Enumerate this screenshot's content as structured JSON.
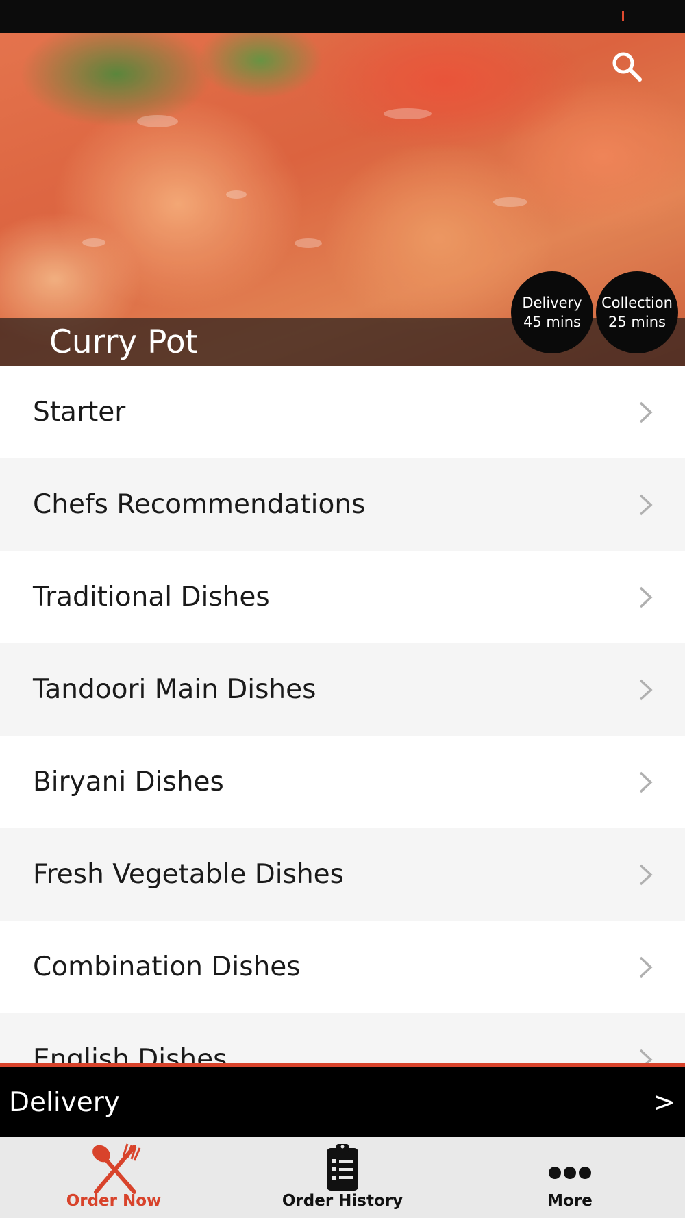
{
  "header": {
    "restaurant_name": "Curry Pot",
    "badges": [
      {
        "label": "Delivery",
        "time": "45 mins"
      },
      {
        "label": "Collection",
        "time": "25 mins"
      }
    ]
  },
  "menu": {
    "categories": [
      {
        "label": "Starter"
      },
      {
        "label": "Chefs Recommendations"
      },
      {
        "label": "Traditional Dishes"
      },
      {
        "label": "Tandoori Main Dishes"
      },
      {
        "label": "Biryani Dishes"
      },
      {
        "label": "Fresh Vegetable Dishes"
      },
      {
        "label": "Combination Dishes"
      },
      {
        "label": "English Dishes"
      }
    ]
  },
  "order_mode_bar": {
    "label": "Delivery",
    "arrow": ">"
  },
  "tabs": [
    {
      "label": "Order Now",
      "icon": "fork-knife-icon",
      "active": true
    },
    {
      "label": "Order History",
      "icon": "clipboard-list-icon",
      "active": false
    },
    {
      "label": "More",
      "icon": "ellipsis-icon",
      "active": false
    }
  ],
  "colors": {
    "accent": "#d8432b",
    "bar_background": "#000000",
    "tab_background": "#e9e9e9"
  }
}
